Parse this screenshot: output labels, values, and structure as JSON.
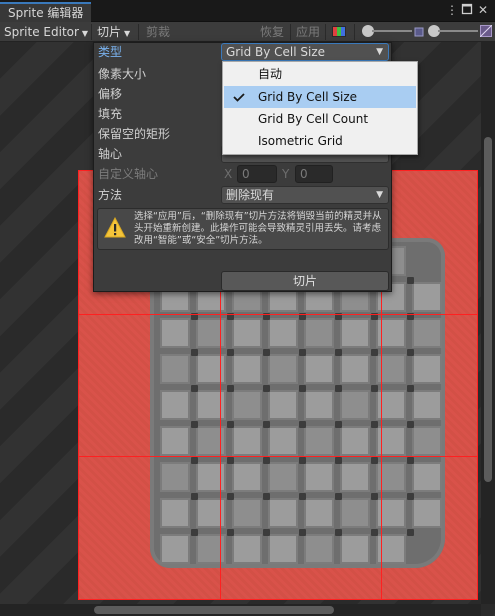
{
  "window": {
    "tab_title": "Sprite 编辑器"
  },
  "toolbar": {
    "mode_label": "Sprite Editor",
    "slice_label": "切片",
    "trim_label": "剪裁",
    "revert_label": "恢复",
    "apply_label": "应用"
  },
  "panel": {
    "type_label": "类型",
    "type_value": "Grid By Cell Size",
    "pixel_size_label": "像素大小",
    "offset_label": "偏移",
    "padding_label": "填充",
    "keep_empty_label": "保留空的矩形",
    "pivot_label": "轴心",
    "custom_pivot_label": "自定义轴心",
    "x_label": "X",
    "x_value": "0",
    "y_label": "Y",
    "y_value": "0",
    "method_label": "方法",
    "method_value": "删除现有",
    "help_text": "选择“应用”后，“删除现有”切片方法将销毁当前的精灵并从头开始重新创建。此操作可能会导致精灵引用丢失。请考虑改用“智能”或“安全”切片方法。",
    "slice_button": "切片"
  },
  "type_menu": {
    "items": [
      {
        "label": "自动",
        "checked": false
      },
      {
        "label": "Grid By Cell Size",
        "checked": true
      },
      {
        "label": "Grid By Cell Count",
        "checked": false
      },
      {
        "label": "Isometric Grid",
        "checked": false
      }
    ]
  },
  "icons": {
    "menu": "kebab-menu-icon",
    "maximize": "maximize-icon",
    "close": "close-icon",
    "color_channels": "rgb-channels-icon",
    "zoom_min": "zoom-small-dot-icon",
    "zoom_max": "mip-level-icon",
    "warning": "warning-triangle-icon"
  },
  "colors": {
    "accent_blue": "#3a79bb",
    "menu_highlight": "#a9cdf2",
    "slice_grid": "#ff2020",
    "sprite_background": "#d9524a",
    "warning_yellow": "#f4c43a"
  }
}
